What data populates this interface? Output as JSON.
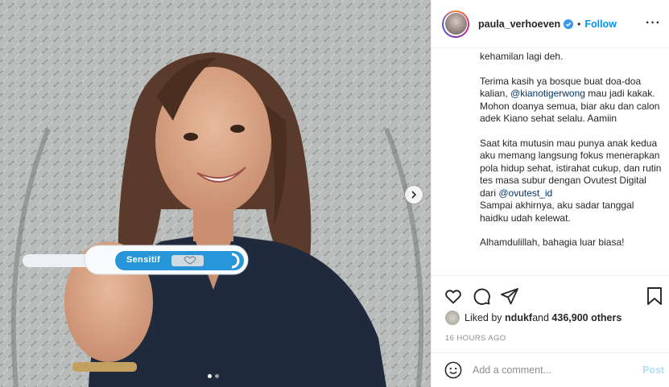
{
  "post": {
    "username": "paula_verhoeven",
    "follow_label": "Follow",
    "separator": "•",
    "more_icon": "more-horizontal-icon",
    "test_brand": "Sensitif",
    "carousel": {
      "count": 2,
      "active": 1
    }
  },
  "caption": {
    "p0": "kehamilan lagi deh.",
    "p1_a": "Terima kasih ya bosque buat doa-doa kalian, ",
    "p1_mention": "@kianotigerwong",
    "p1_b": " mau jadi kakak. Mohon doanya semua, biar aku dan calon adek Kiano sehat selalu. Aamiin",
    "p2_a": "Saat kita mutusin mau punya anak kedua aku memang langsung fokus menerapkan pola hidup sehat, istirahat cukup, dan rutin tes masa subur dengan Ovutest Digital dari ",
    "p2_mention": "@ovutest_id",
    "p2_b": "Sampai akhirnya, aku sadar tanggal haidku udah kelewat.",
    "p3": "Alhamdulillah, bahagia luar biasa!"
  },
  "likes": {
    "prefix": "Liked by ",
    "user": "ndukf",
    "middle": " and ",
    "count": "436,900 others"
  },
  "timestamp": "16 HOURS AGO",
  "comment": {
    "placeholder": "Add a comment...",
    "post_label": "Post"
  },
  "colors": {
    "accent": "#0095f6",
    "post_disabled": "#b2dffc",
    "mention": "#00376b",
    "muted": "#8e8e8e"
  }
}
